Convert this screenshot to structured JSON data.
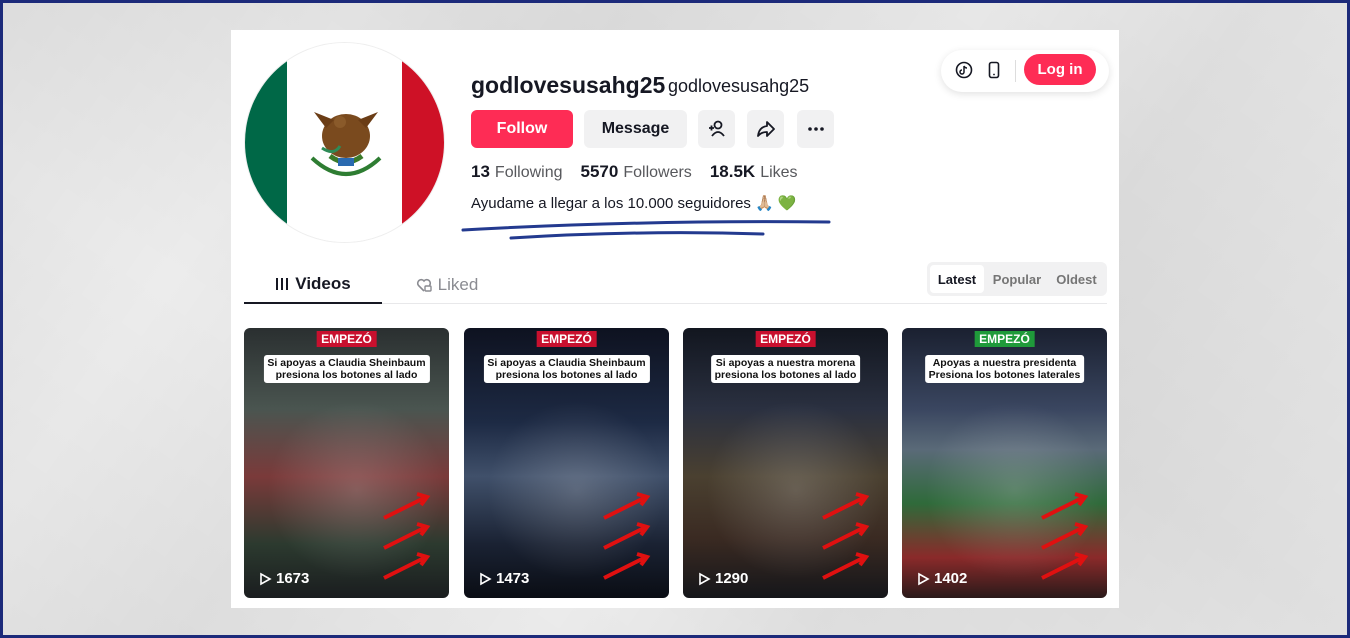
{
  "profile": {
    "username": "godlovesusahg25",
    "nickname": "godlovesusahg25",
    "follow_label": "Follow",
    "message_label": "Message",
    "following_count": "13",
    "following_label": "Following",
    "followers_count": "5570",
    "followers_label": "Followers",
    "likes_count": "18.5K",
    "likes_label": "Likes",
    "bio": "Ayudame a llegar a los 10.000 seguidores 🙏🏼 💚"
  },
  "header": {
    "login_label": "Log in"
  },
  "tabs": [
    {
      "label": "Videos",
      "icon": "grid-icon"
    },
    {
      "label": "Liked",
      "icon": "heart-lock-icon"
    }
  ],
  "sort": {
    "options": [
      "Latest",
      "Popular",
      "Oldest"
    ],
    "selected": "Latest"
  },
  "videos": [
    {
      "banner": "EMPEZÓ",
      "caption_line1": "Si apoyas a Claudia Sheinbaum",
      "caption_line2": "presiona los botones al lado",
      "views": "1673"
    },
    {
      "banner": "EMPEZÓ",
      "caption_line1": "Si apoyas a Claudia Sheinbaum",
      "caption_line2": "presiona los botones al lado",
      "views": "1473"
    },
    {
      "banner": "EMPEZÓ",
      "caption_line1": "Si apoyas a nuestra morena",
      "caption_line2": "presiona los botones al lado",
      "views": "1290"
    },
    {
      "banner": "EMPEZÓ",
      "caption_line1": "Apoyas a nuestra presidenta",
      "caption_line2": "Presiona los botones laterales",
      "views": "1402"
    }
  ],
  "colors": {
    "accent": "#fe2c55",
    "annotation": "#233a8f",
    "frame": "#1c2a7a"
  }
}
